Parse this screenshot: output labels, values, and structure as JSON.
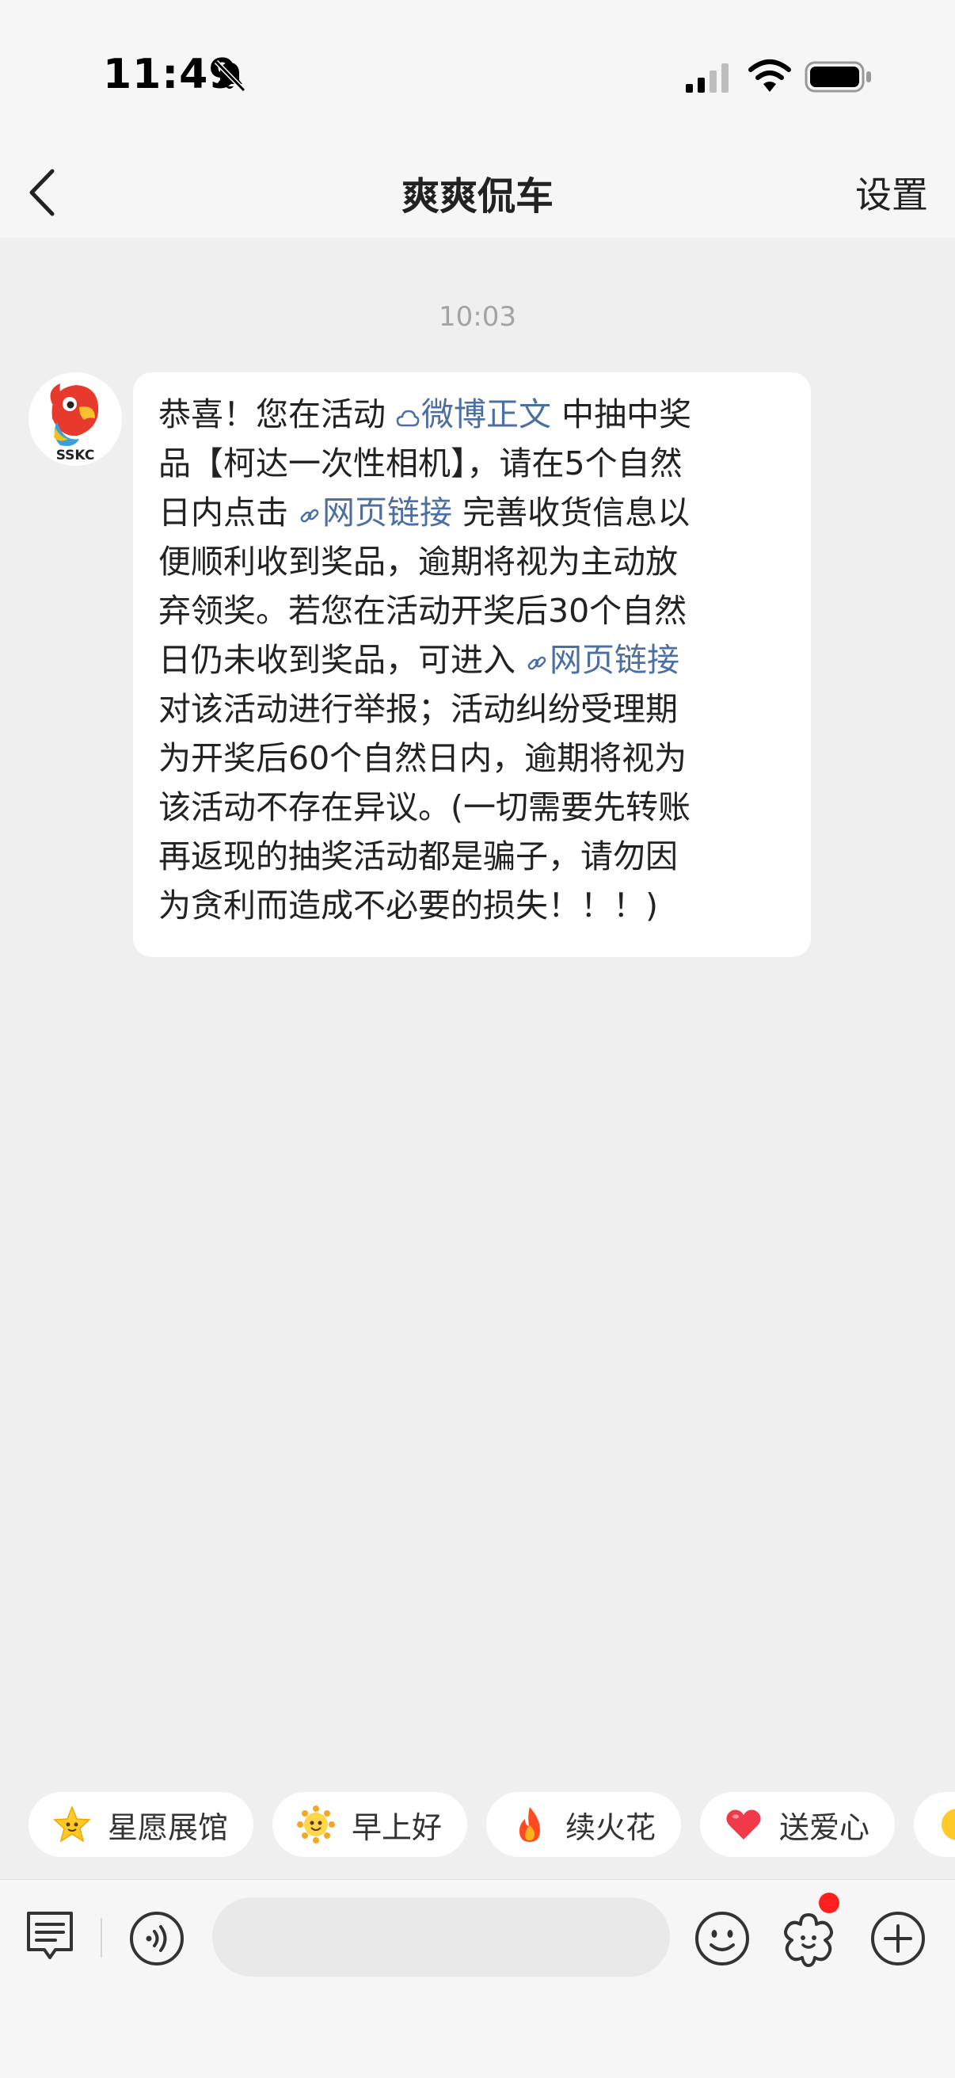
{
  "status_bar": {
    "time": "11:49",
    "icons": [
      "bell-slash-icon",
      "cellular-signal-icon",
      "wifi-icon",
      "battery-icon"
    ]
  },
  "nav": {
    "back_icon": "chevron-left-icon",
    "title": "爽爽侃车",
    "settings": "设置"
  },
  "chat": {
    "timestamp": "10:03",
    "sender_avatar": "SSKC",
    "message": {
      "lines": [
        [
          "恭喜！您在活动 ",
          "微博正文",
          " 中抽中奖"
        ],
        [
          "品【柯达一次性相机】，请在5个自然"
        ],
        [
          "日内点击 ",
          "网页链接",
          " 完善收货信息以"
        ],
        [
          "便顺利收到奖品，逾期将视为主动放"
        ],
        [
          "弃领奖。若您在活动开奖后30个自然"
        ],
        [
          "日仍未收到奖品，可进入 ",
          "网页链接"
        ],
        [
          "对该活动进行举报；活动纠纷受理期"
        ],
        [
          "为开奖后60个自然日内，逾期将视为"
        ],
        [
          "该活动不存在异议。(一切需要先转账"
        ],
        [
          "再返现的抽奖活动都是骗子，请勿因"
        ],
        [
          "为贪利而造成不必要的损失！！！)"
        ]
      ],
      "links": {
        "weibo_post": "微博正文",
        "web_link": "网页链接"
      }
    }
  },
  "quick_replies": [
    {
      "label": "星愿展馆",
      "icon": "star-emoji-icon"
    },
    {
      "label": "早上好",
      "icon": "sun-emoji-icon"
    },
    {
      "label": "续火花",
      "icon": "fire-emoji-icon"
    },
    {
      "label": "送爱心",
      "icon": "heart-emoji-icon"
    }
  ],
  "toolbar": {
    "icons": [
      "message-menu-icon",
      "voice-icon",
      "emoji-icon",
      "flower-icon",
      "plus-icon"
    ],
    "input_placeholder": ""
  },
  "colors": {
    "link": "#4c6fa3",
    "background": "#efefef",
    "notification_dot": "#ff1f1f"
  }
}
